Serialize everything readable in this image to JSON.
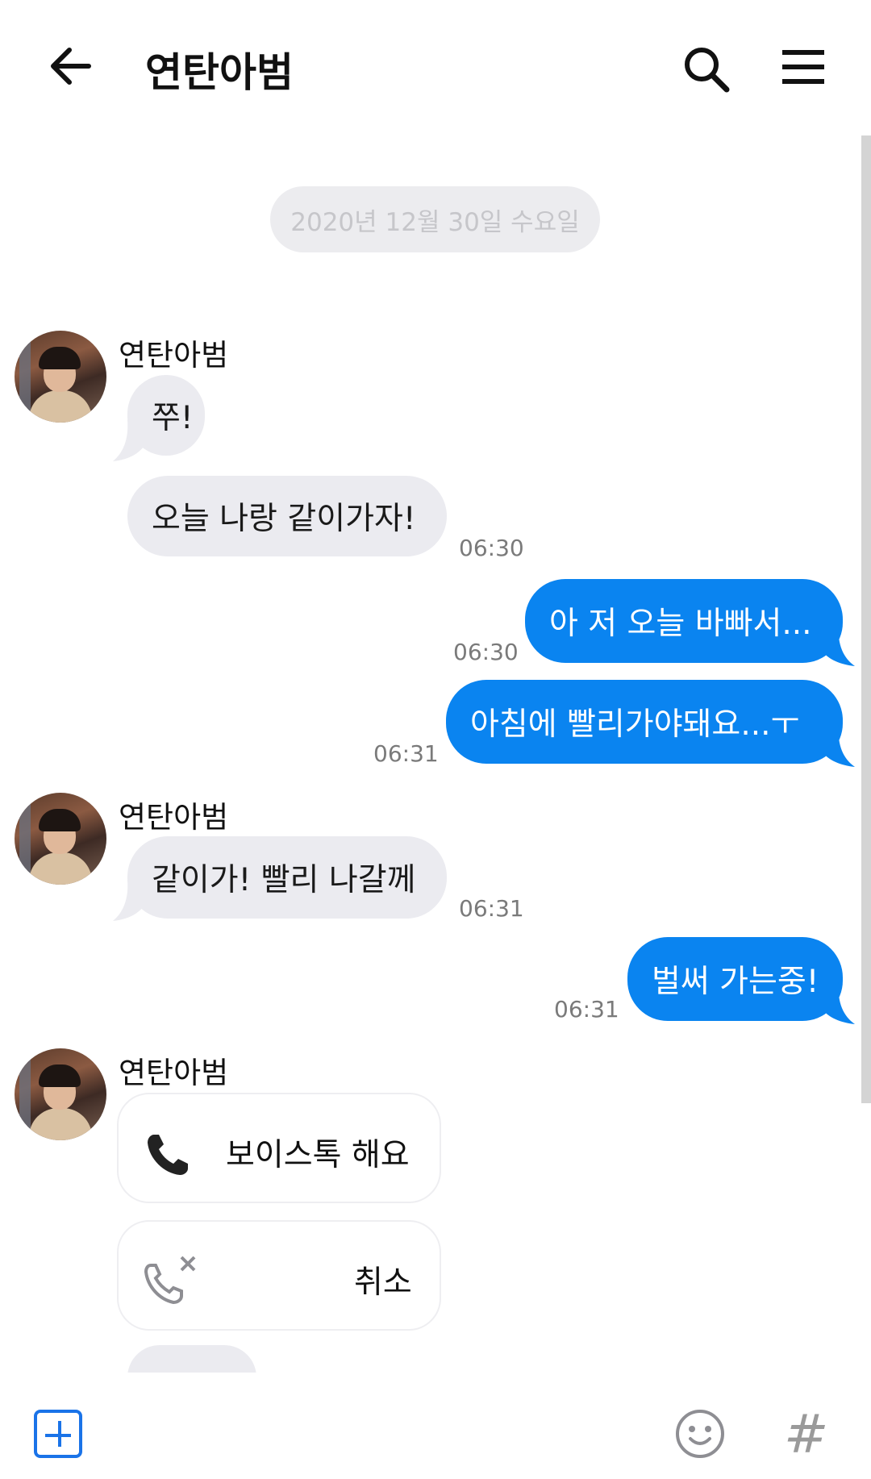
{
  "header": {
    "title": "연탄아범",
    "back_icon": "arrow-left-icon",
    "search_icon": "search-icon",
    "menu_icon": "hamburger-menu-icon"
  },
  "date_divider": "2020년 12월 30일 수요일",
  "messages": [
    {
      "sender": "연탄아범",
      "text": "쭈!",
      "direction": "incoming"
    },
    {
      "text": "오늘 나랑 같이가자!",
      "time": "06:30",
      "direction": "incoming"
    },
    {
      "text": "아 저 오늘 바빠서...",
      "time": "06:30",
      "direction": "outgoing"
    },
    {
      "text": "아침에 빨리가야돼요...ㅜ",
      "time": "06:31",
      "direction": "outgoing"
    },
    {
      "sender": "연탄아범",
      "text": "같이가! 빨리 나갈께",
      "time": "06:31",
      "direction": "incoming"
    },
    {
      "text": "벌써 가는중!",
      "time": "06:31",
      "direction": "outgoing"
    }
  ],
  "voice_message": {
    "sender": "연탄아범",
    "call_label": "보이스톡 해요",
    "cancel_label": "취소",
    "call_icon": "phone-icon",
    "cancel_icon": "phone-cancel-icon"
  },
  "bottom_bar": {
    "add_icon": "plus-square-icon",
    "emoji_icon": "smiley-icon",
    "hash_label": "#"
  },
  "colors": {
    "outgoing_bubble": "#0a84f0",
    "incoming_bubble": "#ebebf0",
    "accent": "#1a73e8"
  }
}
